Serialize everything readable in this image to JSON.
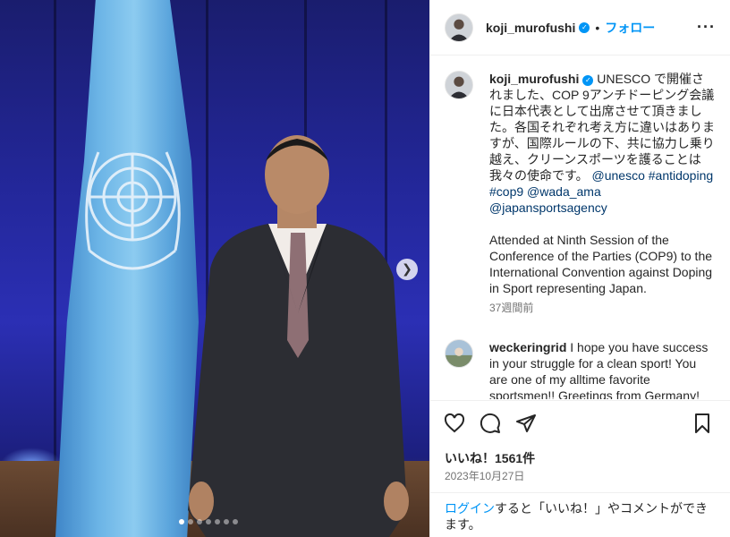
{
  "post": {
    "username": "koji_murofushi",
    "follow_label": "フォロー",
    "header_separator": "•",
    "more_icon": "more-horizontal-icon",
    "caption_jp": "UNESCO で開催されました、COP 9アンチドーピング会議に日本代表として出席させて頂きました。各国それぞれ考え方に違いはありますが、国際ルールの下、共に協力し乗り越え、クリーンスポーツを護ることは我々の使命です。",
    "mentions": [
      "@unesco",
      "#antidoping",
      "#cop9",
      "@wada_ama",
      "@japansportsagency"
    ],
    "caption_en": "Attended at Ninth Session of the Conference of the Parties (COP9) to the International Convention against Doping in Sport representing Japan.",
    "time_ago": "37週間前",
    "comment": {
      "username": "weckeringrid",
      "text": "I hope you have success in your struggle for a clean sport! You are one of my alltime favorite sportsmen!! Greetings from Germany!"
    },
    "likes": "いいね！1561件",
    "date": "2023年10月27日",
    "login_link": "ログイン",
    "login_rest": "すると「いいね！」やコメントができます。"
  },
  "media": {
    "next_icon": "chevron-right-icon",
    "slide_count": 7,
    "active_slide": 1
  },
  "colors": {
    "accent": "#0095f6",
    "hashtag": "#00376b",
    "muted": "#737373"
  }
}
